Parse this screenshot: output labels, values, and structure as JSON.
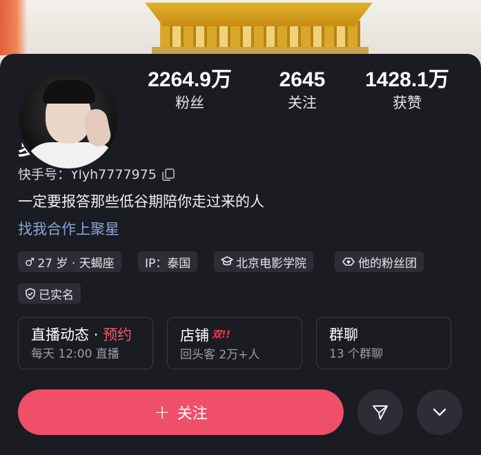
{
  "profile": {
    "name": "夏宁",
    "ks_id_label": "快手号：",
    "ks_id": "Ylyh7777975",
    "bio": "一定要报答那些低谷期陪你走过来的人",
    "cooperation_link": "找我合作上聚星"
  },
  "stats": [
    {
      "value": "2264.9万",
      "label": "粉丝"
    },
    {
      "value": "2645",
      "label": "关注"
    },
    {
      "value": "1428.1万",
      "label": "获赞"
    }
  ],
  "tags": {
    "gender_age": "27 岁 · 天蝎座",
    "ip": "IP：泰国",
    "school": "北京电影学院",
    "fan_group": "他的粉丝团",
    "verified": "已实名"
  },
  "cards": {
    "live": {
      "title": "直播动态",
      "dot": "·",
      "accent": "预约",
      "subtitle": "每天 12:00 直播"
    },
    "shop": {
      "title": "店铺",
      "badge": "双!!",
      "subtitle": "回头客 2万+人"
    },
    "group": {
      "title": "群聊",
      "subtitle": "13 个群聊"
    }
  },
  "actions": {
    "follow_label": "关注",
    "follow_icon": "+"
  },
  "icons": {
    "gender": "male-icon",
    "school": "graduation-cap-icon",
    "fan_group": "heart-badge-icon",
    "verified": "shield-check-icon",
    "copy": "copy-icon",
    "share": "send-icon",
    "more": "chevron-down-icon"
  },
  "colors": {
    "background": "#1b1b22",
    "follow_button": "#f04f69",
    "link": "#8aa6d6",
    "accent": "#ee5a70",
    "chip": "#2d2d35"
  }
}
